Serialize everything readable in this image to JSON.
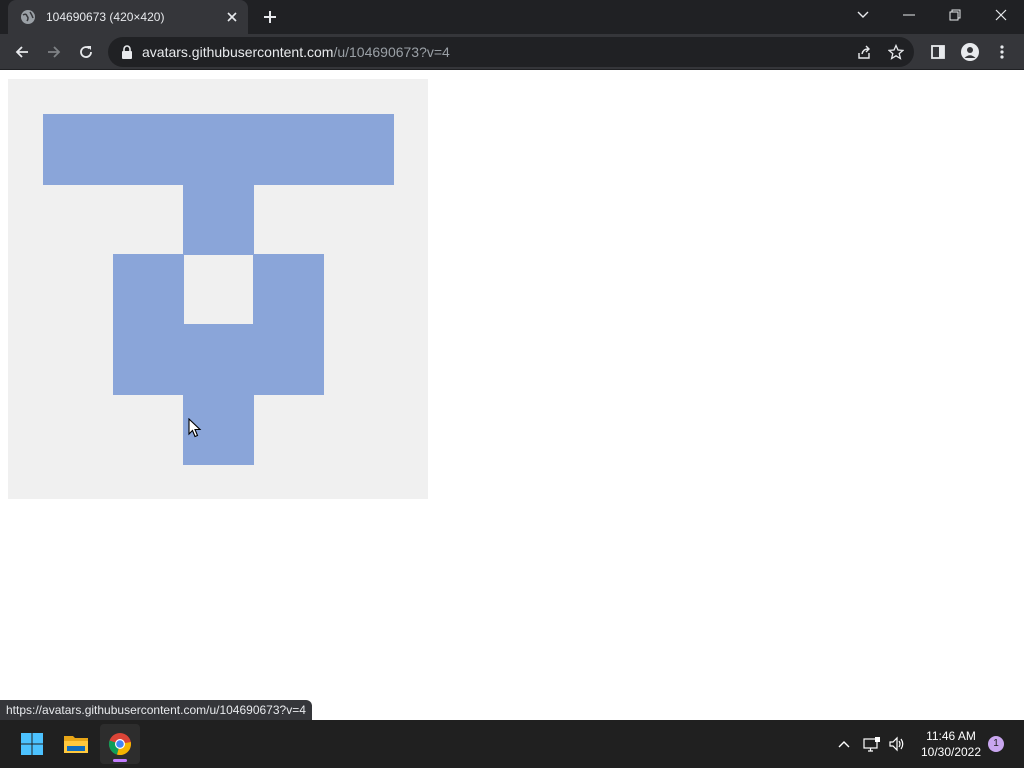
{
  "browser": {
    "tab_title": "104690673 (420×420)",
    "url_host": "avatars.githubusercontent.com",
    "url_path": "/u/104690673?v=4",
    "status_url": "https://avatars.githubusercontent.com/u/104690673?v=4"
  },
  "identicon": {
    "background_color": "#f0f0f0",
    "fill_color": "#8aa5d9",
    "grid_size": 5,
    "filled_cells": [
      [
        0,
        0
      ],
      [
        1,
        0
      ],
      [
        2,
        0
      ],
      [
        3,
        0
      ],
      [
        4,
        0
      ],
      [
        2,
        1
      ],
      [
        1,
        2
      ],
      [
        3,
        2
      ],
      [
        1,
        3
      ],
      [
        2,
        3
      ],
      [
        3,
        3
      ],
      [
        2,
        4
      ]
    ]
  },
  "taskbar": {
    "time": "11:46 AM",
    "date": "10/30/2022",
    "notification_count": "1",
    "apps": [
      "start-icon",
      "file-explorer-icon",
      "chrome-icon"
    ]
  },
  "colors": {
    "tab_strip": "#202124",
    "toolbar": "#35363a",
    "taskbar": "#202020",
    "accent": "#c27cff"
  }
}
